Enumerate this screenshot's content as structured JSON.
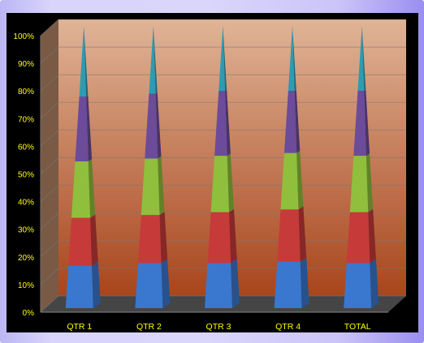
{
  "chart_data": {
    "type": "bar",
    "subtype": "100% stacked 3D pyramid",
    "categories": [
      "QTR 1",
      "QTR 2",
      "QTR 3",
      "QTR 4",
      "TOTAL"
    ],
    "series": [
      {
        "color": "#3a78cf",
        "values": [
          15,
          16,
          16,
          16.5,
          16
        ]
      },
      {
        "color": "#c73a3a",
        "values": [
          17,
          17,
          18,
          18.5,
          18
        ]
      },
      {
        "color": "#8fbf3c",
        "values": [
          20,
          20,
          20,
          20,
          20
        ]
      },
      {
        "color": "#6b4b9a",
        "values": [
          23,
          23,
          23,
          22,
          23
        ]
      },
      {
        "color": "#2e9bb0",
        "values": [
          25,
          24,
          23,
          23,
          23
        ]
      }
    ],
    "yticks": [
      "0%",
      "10%",
      "20%",
      "30%",
      "40%",
      "50%",
      "60%",
      "70%",
      "80%",
      "90%",
      "100%"
    ],
    "ylim": [
      0,
      100
    ],
    "grid": true,
    "legend": "none",
    "wall_gradient": [
      "#e0b497",
      "#a8451c"
    ],
    "floor_color": "#454545",
    "side_wall_color": "#7a5a44"
  }
}
